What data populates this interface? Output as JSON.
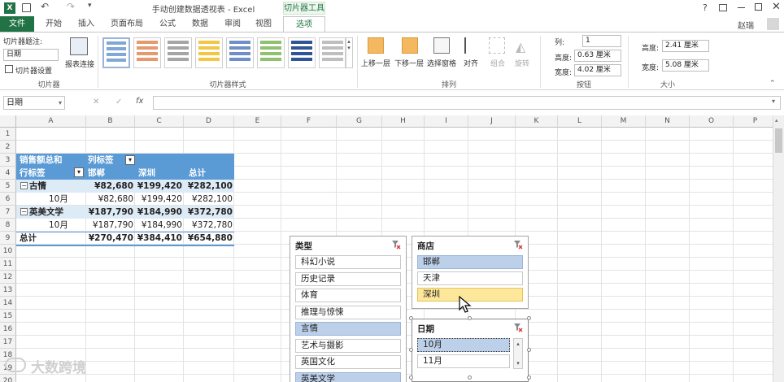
{
  "window": {
    "title": "手动创建数据透视表 - Excel",
    "context_tab_group": "切片器工具",
    "user": "赵瑞",
    "help": "?"
  },
  "tabs": [
    "文件",
    "开始",
    "插入",
    "页面布局",
    "公式",
    "数据",
    "审阅",
    "视图",
    "选项"
  ],
  "ribbon": {
    "slicer_caption_label": "切片器题注:",
    "slicer_caption_value": "日期",
    "slicer_settings": "切片器设置",
    "report_connections": "报表连接",
    "group_slicer": "切片器",
    "group_styles": "切片器样式",
    "bring_forward": "上移一层",
    "send_backward": "下移一层",
    "selection_pane": "选择窗格",
    "align": "对齐",
    "group_btn": "组合",
    "rotate": "旋转",
    "group_arrange": "排列",
    "columns_label": "列:",
    "columns_value": "1",
    "btn_height_label": "高度:",
    "btn_height_value": "0.63 厘米",
    "btn_width_label": "宽度:",
    "btn_width_value": "4.02 厘米",
    "group_buttons": "按钮",
    "size_height_label": "高度:",
    "size_height_value": "2.41 厘米",
    "size_width_label": "宽度:",
    "size_width_value": "5.08 厘米",
    "group_size": "大小",
    "style_colors": [
      "#7fa7d8",
      "#e49a6e",
      "#a5a5a5",
      "#f2c746",
      "#6f8fc8",
      "#8fc16f",
      "#2f5597",
      "#bfbfbf"
    ]
  },
  "formula_bar": {
    "name_box": "日期",
    "fx": "fx",
    "cancel": "✕",
    "enter": "✓"
  },
  "columns": [
    "A",
    "B",
    "C",
    "D",
    "E",
    "F",
    "G",
    "H",
    "I",
    "J",
    "K",
    "L",
    "M",
    "N",
    "O",
    "P"
  ],
  "rows": [
    "1",
    "2",
    "3",
    "4",
    "5",
    "6",
    "7",
    "8",
    "9",
    "10",
    "11",
    "12",
    "13",
    "14",
    "15",
    "16",
    "17",
    "18",
    "19",
    "20"
  ],
  "pivot": {
    "r3": {
      "a": "销售额总和",
      "b": "列标签"
    },
    "r4": {
      "a": "行标签",
      "b": "邯郸",
      "c": "深圳",
      "d": "总计"
    },
    "r5": {
      "a": "古情",
      "b": "¥82,680",
      "c": "¥199,420",
      "d": "¥282,100"
    },
    "r6": {
      "a": "10月",
      "b": "¥82,680",
      "c": "¥199,420",
      "d": "¥282,100"
    },
    "r7": {
      "a": "英美文学",
      "b": "¥187,790",
      "c": "¥184,990",
      "d": "¥372,780"
    },
    "r8": {
      "a": "10月",
      "b": "¥187,790",
      "c": "¥184,990",
      "d": "¥372,780"
    },
    "r9": {
      "a": "总计",
      "b": "¥270,470",
      "c": "¥384,410",
      "d": "¥654,880"
    }
  },
  "slicer_type": {
    "title": "类型",
    "items": [
      "科幻小说",
      "历史记录",
      "体育",
      "推理与惊悚",
      "言情",
      "艺术与摄影",
      "英国文化",
      "英美文学"
    ]
  },
  "slicer_store": {
    "title": "商店",
    "items": [
      "邯郸",
      "天津",
      "深圳"
    ]
  },
  "slicer_date": {
    "title": "日期",
    "items": [
      "10月",
      "11月"
    ]
  },
  "watermark": "大数跨境"
}
